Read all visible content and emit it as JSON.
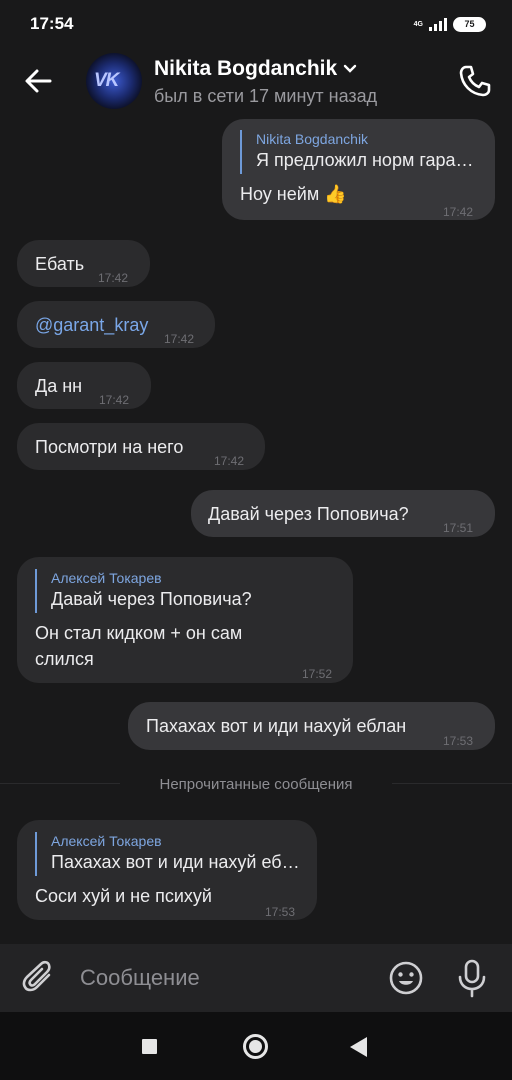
{
  "status_bar": {
    "time": "17:54",
    "network": "4G",
    "battery": "75"
  },
  "header": {
    "name": "Nikita Bogdanchik",
    "last_seen": "был в сети 17 минут назад",
    "avatar_text": "VK"
  },
  "messages": [
    {
      "dir": "out",
      "reply_name": "Nikita Bogdanchik",
      "reply_text": "Я предложил норм гара…",
      "text": "Ноу нейм 👍",
      "time": "17:42"
    },
    {
      "dir": "in",
      "text": "Ебать",
      "time": "17:42"
    },
    {
      "dir": "in",
      "text": "@garant_kray",
      "time": "17:42"
    },
    {
      "dir": "in",
      "text": "Да нн",
      "time": "17:42"
    },
    {
      "dir": "in",
      "text": "Посмотри на него",
      "time": "17:42"
    },
    {
      "dir": "out",
      "text": "Давай через Поповича?",
      "time": "17:51"
    },
    {
      "dir": "in",
      "reply_name": "Алексей Токарев",
      "reply_text": "Давай через Поповича?",
      "text_line1": "Он стал кидком + он сам",
      "text_line2": "слился",
      "time": "17:52"
    },
    {
      "dir": "out",
      "text": "Пахахах вот и иди нахуй еблан",
      "time": "17:53"
    },
    {
      "dir": "in",
      "reply_name": "Алексей Токарев",
      "reply_text": "Пахахах вот и иди нахуй еб…",
      "text": "Соси хуй и не психуй",
      "time": "17:53"
    }
  ],
  "unread_divider": "Непрочитанные сообщения",
  "composer": {
    "placeholder": "Сообщение"
  }
}
